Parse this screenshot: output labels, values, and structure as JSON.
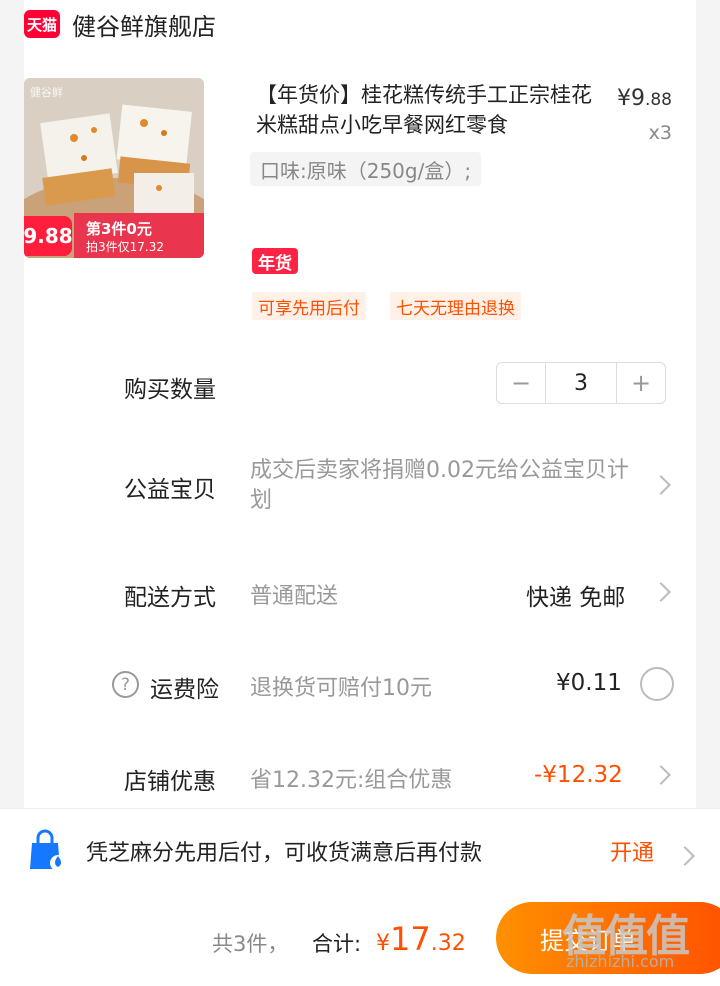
{
  "shop": {
    "badge": "天猫",
    "name": "健谷鲜旗舰店"
  },
  "product": {
    "image_brand": "健谷鲜",
    "image_price": "9.88",
    "image_deal": "第3件0元",
    "image_deal_sub": "拍3件仅17.32",
    "title": "【年货价】桂花糕传统手工正宗桂花米糕甜点小吃早餐网红零食",
    "price_currency": "¥",
    "price_int": "9",
    "price_dec": ".88",
    "quantity_label": "x3",
    "sku": "口味:原味（250g/盒）;",
    "badge": "年货",
    "tags": [
      "可享先用后付",
      "七天无理由退换"
    ]
  },
  "quantity_row": {
    "label": "购买数量",
    "value": "3",
    "minus": "−",
    "plus": "+"
  },
  "charity_row": {
    "label": "公益宝贝",
    "desc": "成交后卖家将捐赠0.02元给公益宝贝计划"
  },
  "delivery_row": {
    "label": "配送方式",
    "desc": "普通配送",
    "value": "快递 免邮"
  },
  "insurance_row": {
    "help": "?",
    "label": "运费险",
    "desc": "退换货可赔付10元",
    "value": "¥0.11"
  },
  "shop_discount_row": {
    "label": "店铺优惠",
    "desc": "省12.32元:组合优惠",
    "value": "-¥12.32"
  },
  "banner": {
    "text": "凭芝麻分先用后付，可收货满意后再付款",
    "action": "开通"
  },
  "footer": {
    "count": "共3件，",
    "total_label": "合计:",
    "currency": "¥",
    "total_int": "17",
    "total_dec": ".32",
    "submit": "提交订单",
    "watermark": "值值值",
    "watermark_sub": "zhizhizhi.com"
  },
  "colors": {
    "accent": "#ff5000",
    "tmall_red": "#ff0036"
  }
}
